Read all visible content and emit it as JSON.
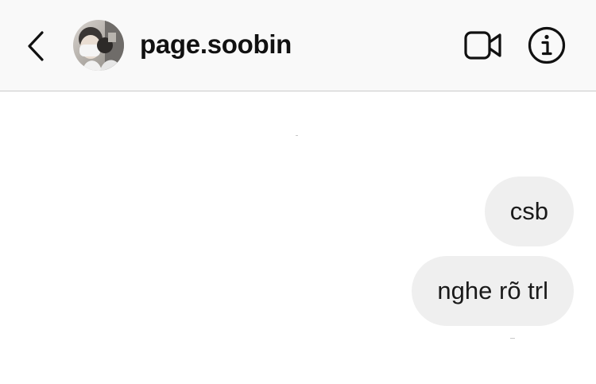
{
  "header": {
    "username": "page.soobin",
    "icons": {
      "back": "chevron-left-icon",
      "video": "video-camera-icon",
      "info": "info-icon"
    },
    "colors": {
      "header_bg": "#f9f9f9",
      "icon": "#111111",
      "bubble_bg": "#efefef"
    }
  },
  "messages": [
    {
      "sender": "self",
      "text": "csb"
    },
    {
      "sender": "self",
      "text": "nghe rõ trl"
    }
  ]
}
